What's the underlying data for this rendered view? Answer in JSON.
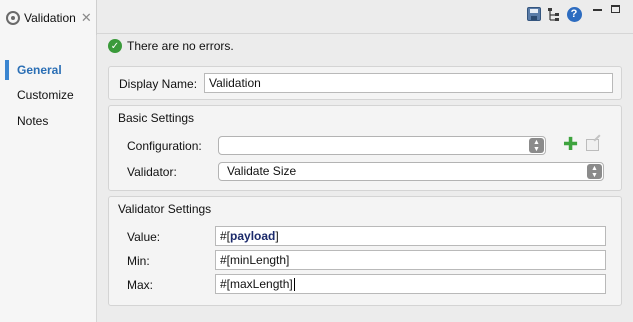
{
  "tab": {
    "title": "Validation",
    "close": "✕"
  },
  "toolbar": {
    "save_icon": "save-icon",
    "tree_icon": "tree-icon",
    "help_icon": "help-icon",
    "help_glyph": "?"
  },
  "nav": {
    "items": [
      {
        "label": "General",
        "active": true
      },
      {
        "label": "Customize",
        "active": false
      },
      {
        "label": "Notes",
        "active": false
      }
    ]
  },
  "status": {
    "text": "There are no errors.",
    "icon": "check-icon",
    "color": "#3a9a3a"
  },
  "display_name": {
    "label": "Display Name:",
    "value": "Validation"
  },
  "basic_settings": {
    "title": "Basic Settings",
    "configuration": {
      "label": "Configuration:",
      "value": ""
    },
    "validator": {
      "label": "Validator:",
      "value": "Validate Size"
    }
  },
  "validator_settings": {
    "title": "Validator Settings",
    "value": {
      "label": "Value:",
      "prefix": "#[",
      "expr": "payload",
      "suffix": "]"
    },
    "min": {
      "label": "Min:",
      "value": "#[minLength]"
    },
    "max": {
      "label": "Max:",
      "value": "#[maxLength]"
    }
  },
  "colors": {
    "accent": "#2b6fb5",
    "add_icon": "#3ea33e"
  }
}
